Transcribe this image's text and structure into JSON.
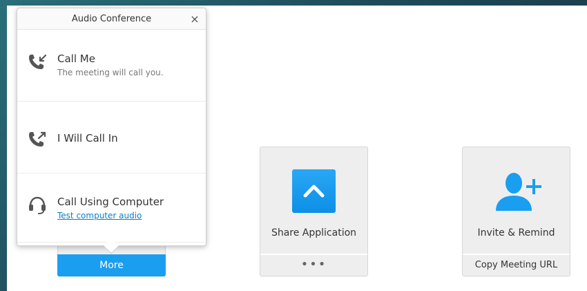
{
  "popover": {
    "title": "Audio Conference",
    "close": "×",
    "options": [
      {
        "title": "Call Me",
        "subtitle": "The meeting will call you.",
        "icon": "phone-incoming-icon"
      },
      {
        "title": "I Will Call In",
        "icon": "phone-outgoing-icon"
      },
      {
        "title": "Call Using Computer",
        "link": "Test computer audio",
        "icon": "headset-icon"
      }
    ]
  },
  "cards": {
    "more": {
      "button_label": "More"
    },
    "share": {
      "label": "Share Application",
      "footer": "•••",
      "icon": "chevron-up-icon"
    },
    "invite": {
      "label": "Invite & Remind",
      "footer": "Copy Meeting URL",
      "icon": "add-user-icon"
    }
  },
  "colors": {
    "accent": "#1a9ef0",
    "link": "#0a7fc4"
  }
}
